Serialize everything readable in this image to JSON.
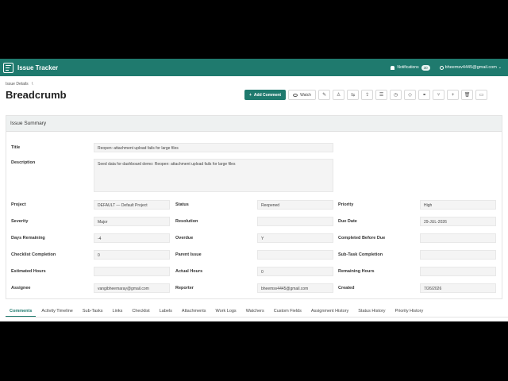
{
  "app": {
    "title": "Issue Tracker"
  },
  "topbar": {
    "notifications_label": "Notifications",
    "notifications_count": "30",
    "user": "bheemsv4445@gmail.com"
  },
  "breadcrumb": {
    "item": "Issue Details",
    "separator": "\\"
  },
  "page": {
    "title": "Breadcrumb"
  },
  "toolbar": {
    "add_comment": "Add Comment",
    "add_icon": "+",
    "watch": "Watch",
    "icons": [
      "edit-icon",
      "assign-icon",
      "transfer-icon",
      "upload-icon",
      "list-icon",
      "clock-icon",
      "tag-icon",
      "link-icon",
      "branch-icon",
      "plus-icon",
      "trash-icon",
      "more-icon"
    ],
    "icon_glyphs": [
      "✎",
      "♙",
      "⇆",
      "⇪",
      "☰",
      "◷",
      "◇",
      "⚭",
      "⑂",
      "+",
      "🗑",
      "▭"
    ]
  },
  "summary": {
    "header": "Issue Summary",
    "title_label": "Title",
    "title_value": "Reopen: attachment upload fails for large files",
    "description_label": "Description",
    "description_value": "Seed data for dashboard demo: Reopen: attachment upload fails for large files",
    "fields": [
      {
        "label": "Project",
        "value": "DEFAULT — Default Project"
      },
      {
        "label": "Status",
        "value": "Reopened"
      },
      {
        "label": "Priority",
        "value": "High"
      },
      {
        "label": "Severity",
        "value": "Major"
      },
      {
        "label": "Resolution",
        "value": ""
      },
      {
        "label": "Due Date",
        "value": "29-JUL-2026"
      },
      {
        "label": "Days Remaining",
        "value": "-4"
      },
      {
        "label": "Overdue",
        "value": "Y"
      },
      {
        "label": "Completed Before Due",
        "value": ""
      },
      {
        "label": "Checklist Completion",
        "value": "0"
      },
      {
        "label": "Parent Issue",
        "value": ""
      },
      {
        "label": "Sub-Task Completion",
        "value": ""
      },
      {
        "label": "Estimated Hours",
        "value": ""
      },
      {
        "label": "Actual Hours",
        "value": "0"
      },
      {
        "label": "Remaining Hours",
        "value": ""
      },
      {
        "label": "Assignee",
        "value": "vangibheemaray@gmail.com"
      },
      {
        "label": "Reporter",
        "value": "bheemsv4445@gmail.com"
      },
      {
        "label": "Created",
        "value": "7/26/2026"
      }
    ]
  },
  "tabs": [
    "Comments",
    "Activity Timeline",
    "Sub-Tasks",
    "Links",
    "Checklist",
    "Labels",
    "Attachments",
    "Work Logs",
    "Watchers",
    "Custom Fields",
    "Assignment History",
    "Status History",
    "Priority History"
  ],
  "colors": {
    "brand": "#1f7a6e",
    "header_bg": "#eef1f1",
    "field_bg": "#f4f4f4"
  }
}
